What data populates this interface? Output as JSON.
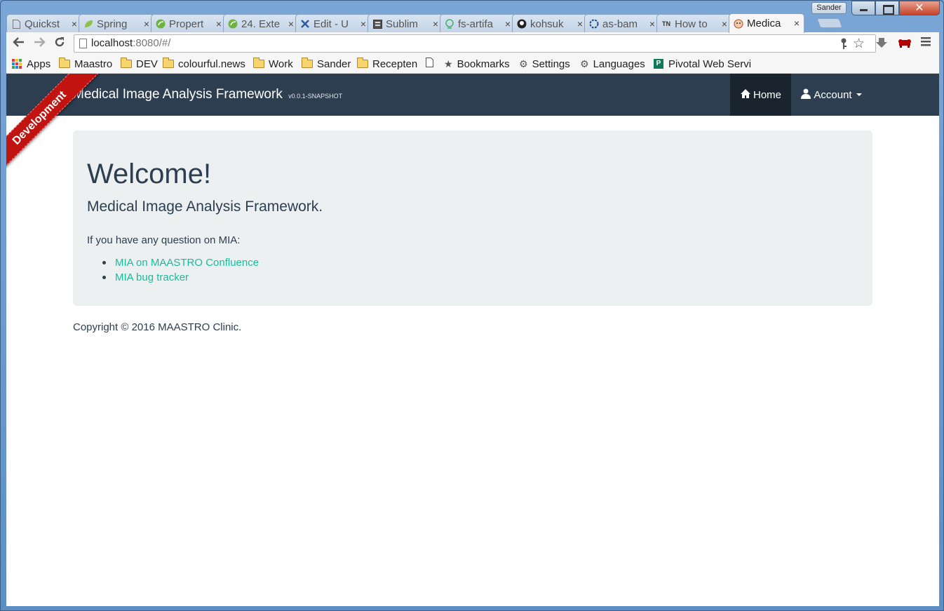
{
  "browser": {
    "profile_name": "Sander",
    "tabs": [
      {
        "label": "Quickst",
        "icon": "page-icon"
      },
      {
        "label": "Spring",
        "icon": "spring-leaf-icon"
      },
      {
        "label": "Propert",
        "icon": "spring-icon"
      },
      {
        "label": "24. Exte",
        "icon": "spring-icon"
      },
      {
        "label": "Edit - U",
        "icon": "tools-icon"
      },
      {
        "label": "Sublim",
        "icon": "sublime-icon"
      },
      {
        "label": "fs-artifa",
        "icon": "artifact-icon"
      },
      {
        "label": "kohsuk",
        "icon": "github-icon"
      },
      {
        "label": "as-bam",
        "icon": "atlassian-icon"
      },
      {
        "label": "How to",
        "icon": "tn-icon"
      },
      {
        "label": "Medica",
        "icon": "medical-icon",
        "active": true
      }
    ],
    "close_glyph": "×",
    "url_host": "localhost",
    "url_rest": ":8080/#/",
    "bookmarks": [
      {
        "label": "Apps",
        "type": "apps"
      },
      {
        "label": "Maastro",
        "type": "folder"
      },
      {
        "label": "DEV",
        "type": "folder"
      },
      {
        "label": "colourful.news",
        "type": "folder"
      },
      {
        "label": "Work",
        "type": "folder"
      },
      {
        "label": "Sander",
        "type": "folder"
      },
      {
        "label": "Recepten",
        "type": "folder"
      },
      {
        "label": "",
        "type": "page"
      },
      {
        "label": "Bookmarks",
        "type": "star"
      },
      {
        "label": "Settings",
        "type": "gear"
      },
      {
        "label": "Languages",
        "type": "gear"
      },
      {
        "label": "Pivotal Web Servi",
        "type": "pivotal"
      }
    ]
  },
  "app": {
    "brand": "Medical Image Analysis Framework",
    "version": "v0.0.1-SNAPSHOT",
    "ribbon": "Development",
    "nav": {
      "home": "Home",
      "account": "Account"
    },
    "colors": {
      "navbar": "#2c3e50",
      "active_nav": "#1a242f",
      "link": "#18bc9c",
      "ribbon": "#c1130f"
    }
  },
  "main": {
    "title": "Welcome!",
    "subtitle": "Medical Image Analysis Framework.",
    "intro": "If you have any question on MIA:",
    "links": [
      "MIA on MAASTRO Confluence",
      "MIA bug tracker"
    ],
    "footer": "Copyright © 2016 MAASTRO Clinic."
  }
}
